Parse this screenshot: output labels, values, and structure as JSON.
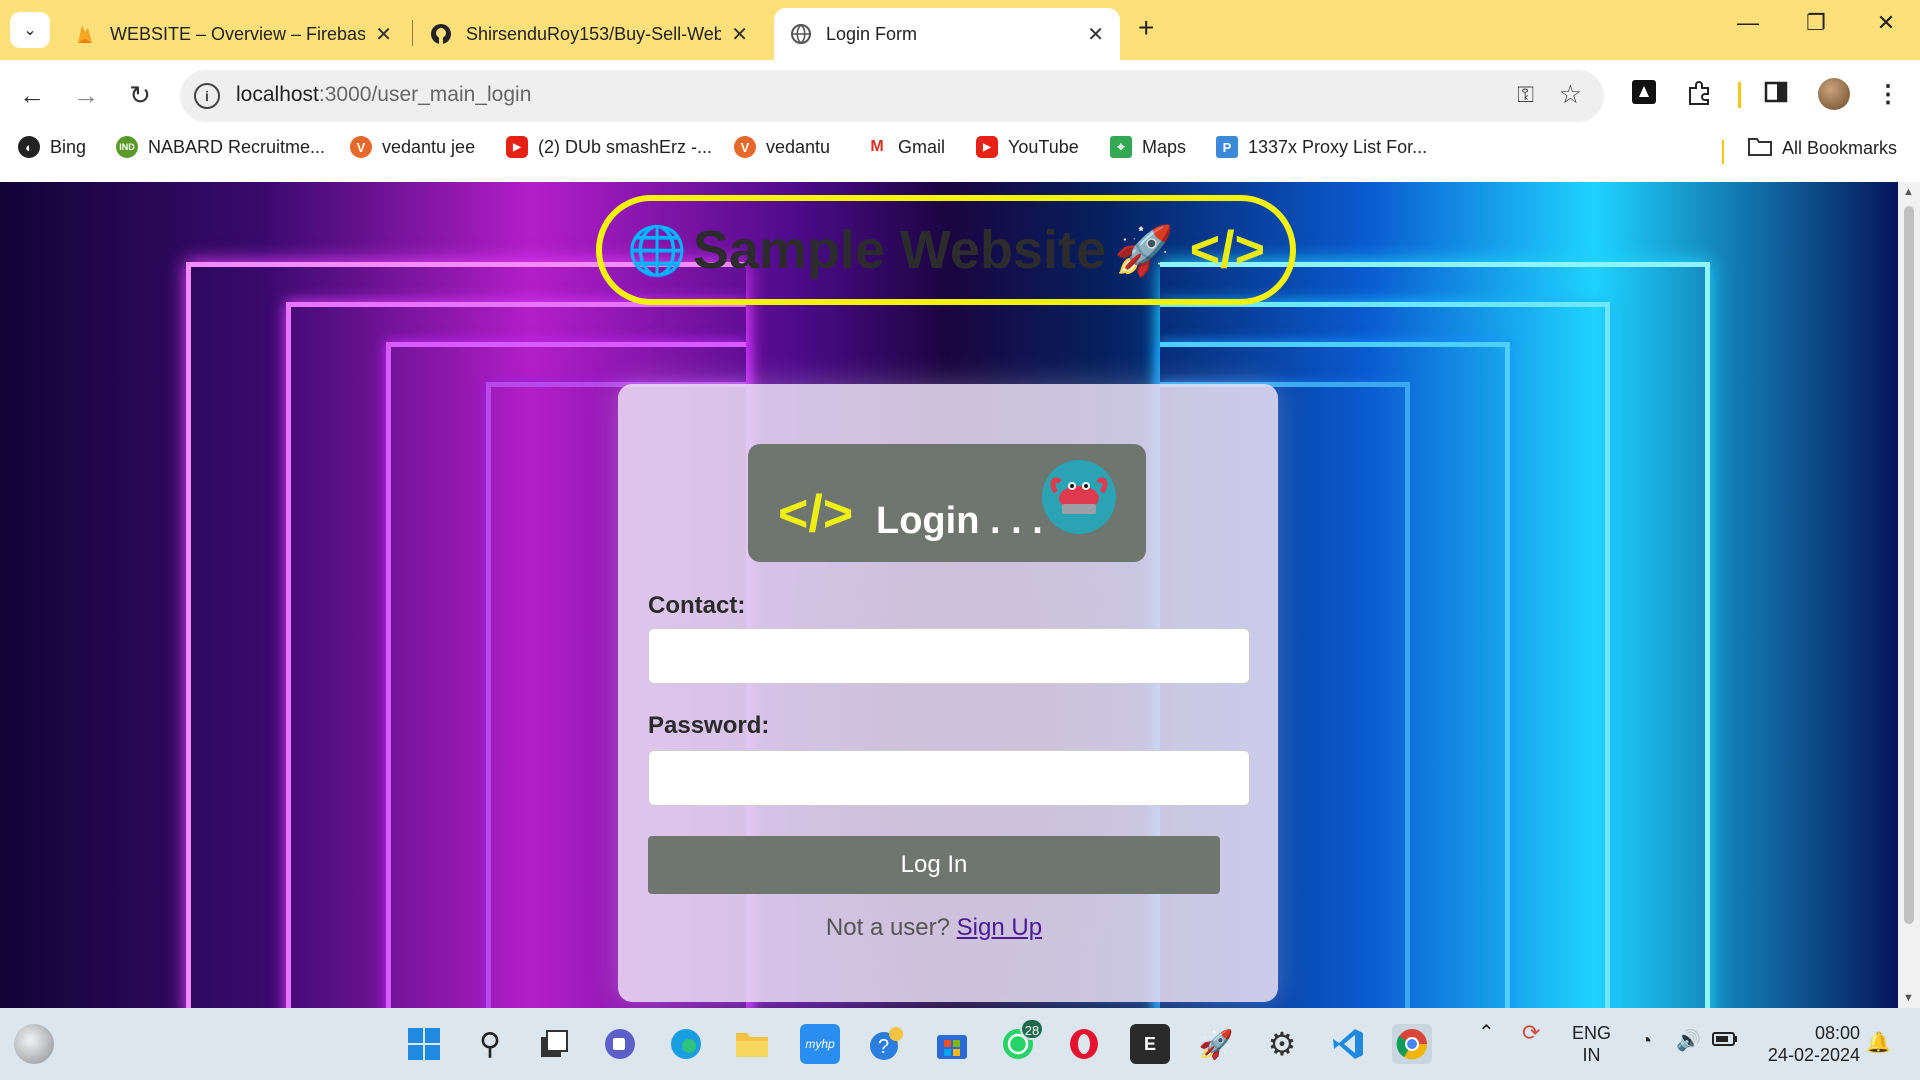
{
  "browser": {
    "tabs": [
      {
        "title": "WEBSITE – Overview – Firebase",
        "favicon": "firebase-icon",
        "active": false
      },
      {
        "title": "ShirsenduRoy153/Buy-Sell-Web",
        "favicon": "github-icon",
        "active": false
      },
      {
        "title": "Login Form",
        "favicon": "globe-icon",
        "active": true
      }
    ],
    "address": {
      "host": "localhost",
      "path": ":3000/user_main_login"
    },
    "bookmarks": [
      {
        "label": "Bing",
        "icon": "bing-icon",
        "color": "#222222"
      },
      {
        "label": "NABARD Recruitme...",
        "icon": "ind-icon",
        "color": "#5a9a2a"
      },
      {
        "label": "vedantu jee",
        "icon": "vedantu-icon",
        "color": "#e8672b"
      },
      {
        "label": "(2) DUb smashErz -...",
        "icon": "youtube-icon",
        "color": "#e62117"
      },
      {
        "label": "vedantu",
        "icon": "vedantu-icon",
        "color": "#e8672b"
      },
      {
        "label": "Gmail",
        "icon": "gmail-icon",
        "color": "#d93025"
      },
      {
        "label": "YouTube",
        "icon": "youtube-icon",
        "color": "#e62117"
      },
      {
        "label": "Maps",
        "icon": "maps-icon",
        "color": "#34a853"
      },
      {
        "label": "1337x Proxy List For...",
        "icon": "proxy-icon",
        "color": "#3b8ad9"
      }
    ],
    "all_bookmarks": "All Bookmarks"
  },
  "page": {
    "site_title": "Sample Website",
    "code_symbol": "</>",
    "login_heading": "Login . . .",
    "contact_label": "Contact:",
    "contact_value": "",
    "password_label": "Password:",
    "password_value": "",
    "login_button": "Log In",
    "signup_prompt": "Not a user?",
    "signup_link": "Sign Up"
  },
  "taskbar": {
    "apps": [
      "windows-start-icon",
      "search-icon",
      "task-view-icon",
      "teams-icon",
      "edge-icon",
      "file-explorer-icon",
      "myhp-icon",
      "get-help-icon",
      "microsoft-store-icon",
      "whatsapp-icon",
      "opera-icon",
      "epic-games-icon",
      "rocket-app-icon",
      "settings-gear-icon",
      "vscode-icon",
      "chrome-icon"
    ],
    "whatsapp_badge": "28",
    "language": "ENG",
    "region": "IN",
    "time": "08:00",
    "date": "24-02-2024"
  },
  "colors": {
    "tab_strip": "#fde07a",
    "title_border": "#f2f20c",
    "button": "#6f7670",
    "link": "#4a1a9a"
  }
}
